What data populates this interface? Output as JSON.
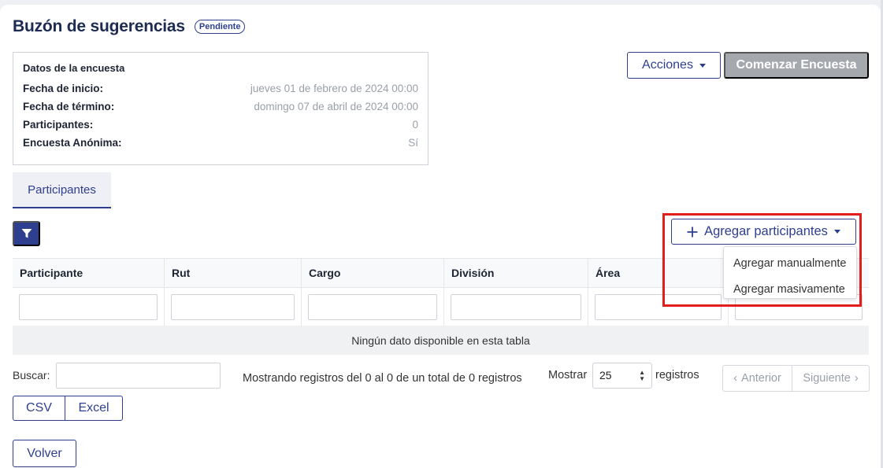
{
  "header": {
    "title": "Buzón de sugerencias",
    "status_badge": "Pendiente"
  },
  "survey": {
    "heading": "Datos de la encuesta",
    "rows": [
      {
        "label": "Fecha de inicio:",
        "value": "jueves 01 de febrero de 2024 00:00"
      },
      {
        "label": "Fecha de término:",
        "value": "domingo 07 de abril de 2024 00:00"
      },
      {
        "label": "Participantes:",
        "value": "0"
      },
      {
        "label": "Encuesta Anónima:",
        "value": "Sí"
      }
    ]
  },
  "actions": {
    "acciones_label": "Acciones",
    "comenzar_label": "Comenzar Encuesta"
  },
  "tabs": [
    {
      "label": "Participantes"
    }
  ],
  "toolbar": {
    "filter_icon": "filter-icon",
    "add_participants_label": "Agregar participantes",
    "add_icon": "plus-icon",
    "dropdown_items": [
      "Agregar manualmente",
      "Agregar masivamente"
    ]
  },
  "table": {
    "columns": [
      "Participante",
      "Rut",
      "Cargo",
      "División",
      "Área",
      ""
    ],
    "empty_message": "Ningún dato disponible en esta tabla"
  },
  "footer": {
    "search_label": "Buscar:",
    "info": "Mostrando registros del 0 al 0 de un total de 0 registros",
    "show_label": "Mostrar",
    "page_size": "25",
    "records_label": "registros",
    "prev_label": "Anterior",
    "next_label": "Siguiente",
    "export": [
      "CSV",
      "Excel"
    ],
    "back_label": "Volver"
  },
  "colors": {
    "primary": "#2f3f8f",
    "disabled": "#a5a9ae",
    "highlight": "#e31c1c"
  }
}
